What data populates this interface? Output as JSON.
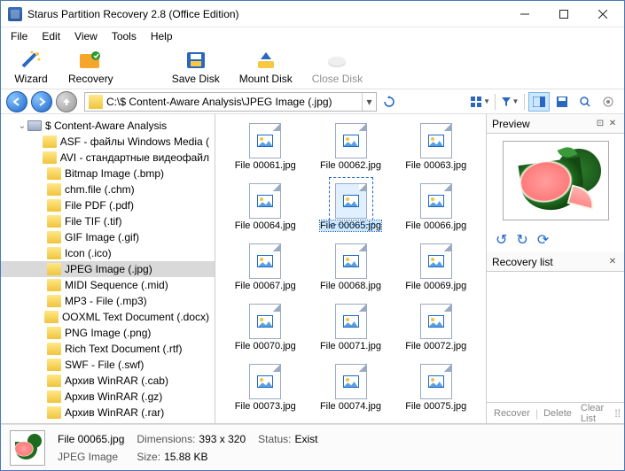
{
  "window": {
    "title": "Starus Partition Recovery 2.8 (Office Edition)"
  },
  "menu": {
    "file": "File",
    "edit": "Edit",
    "view": "View",
    "tools": "Tools",
    "help": "Help"
  },
  "toolbar": {
    "wizard": "Wizard",
    "recovery": "Recovery",
    "savedisk": "Save Disk",
    "mountdisk": "Mount Disk",
    "closedisk": "Close Disk"
  },
  "addressbar": {
    "path": "C:\\$ Content-Aware Analysis\\JPEG Image (.jpg)"
  },
  "tree": {
    "root": "$ Content-Aware Analysis",
    "items": [
      "ASF - файлы Windows Media (",
      "AVI - стандартные видеофайл",
      "Bitmap Image (.bmp)",
      "chm.file (.chm)",
      "File PDF (.pdf)",
      "File TIF (.tif)",
      "GIF Image (.gif)",
      "Icon (.ico)",
      "JPEG Image (.jpg)",
      "MIDI Sequence (.mid)",
      "MP3 - File (.mp3)",
      "OOXML Text Document (.docx)",
      "PNG Image (.png)",
      "Rich Text Document (.rtf)",
      "SWF - File (.swf)",
      "Архив WinRAR (.cab)",
      "Архив WinRAR (.gz)",
      "Архив WinRAR (.rar)"
    ],
    "selectedIndex": 8
  },
  "files": {
    "items": [
      "File 00061.jpg",
      "File 00062.jpg",
      "File 00063.jpg",
      "File 00064.jpg",
      "File 00065.jpg",
      "File 00066.jpg",
      "File 00067.jpg",
      "File 00068.jpg",
      "File 00069.jpg",
      "File 00070.jpg",
      "File 00071.jpg",
      "File 00072.jpg",
      "File 00073.jpg",
      "File 00074.jpg",
      "File 00075.jpg"
    ],
    "selectedIndex": 4
  },
  "preview": {
    "title": "Preview"
  },
  "recoverylist": {
    "title": "Recovery list",
    "recover": "Recover",
    "delete": "Delete",
    "clear": "Clear List"
  },
  "status": {
    "filename": "File 00065.jpg",
    "filetype": "JPEG Image",
    "dim_label": "Dimensions:",
    "dim_value": "393 x 320",
    "size_label": "Size:",
    "size_value": "15.88 KB",
    "status_label": "Status:",
    "status_value": "Exist"
  }
}
